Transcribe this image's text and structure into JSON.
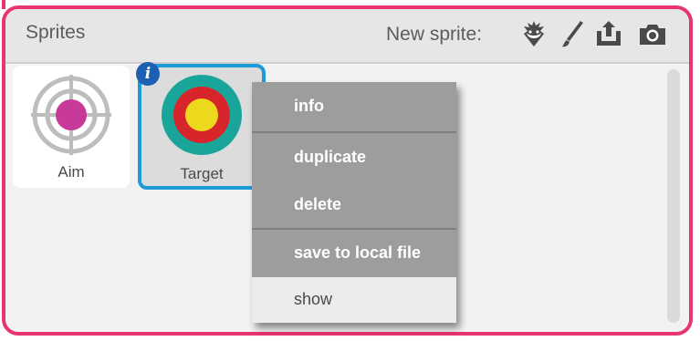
{
  "panel": {
    "title": "Sprites",
    "new_sprite_label": "New sprite:",
    "border_color": "#e8356f"
  },
  "header_icons": [
    "choose-sprite-icon",
    "paint-brush-icon",
    "upload-sprite-icon",
    "camera-icon"
  ],
  "sprites": [
    {
      "name": "Aim",
      "selected": false
    },
    {
      "name": "Target",
      "selected": true,
      "info_badge": "i"
    }
  ],
  "context_menu": {
    "items": [
      {
        "label": "info"
      },
      {
        "label": "duplicate"
      },
      {
        "label": "delete"
      },
      {
        "label": "save to local file"
      },
      {
        "label": "show"
      }
    ]
  },
  "colors": {
    "selection": "#1f9ad8",
    "menu_bg": "#9d9d9d",
    "aim_center": "#c83a9a",
    "target_outer": "#1aa59b",
    "target_middle": "#d8252b",
    "target_inner": "#ecd81c"
  }
}
